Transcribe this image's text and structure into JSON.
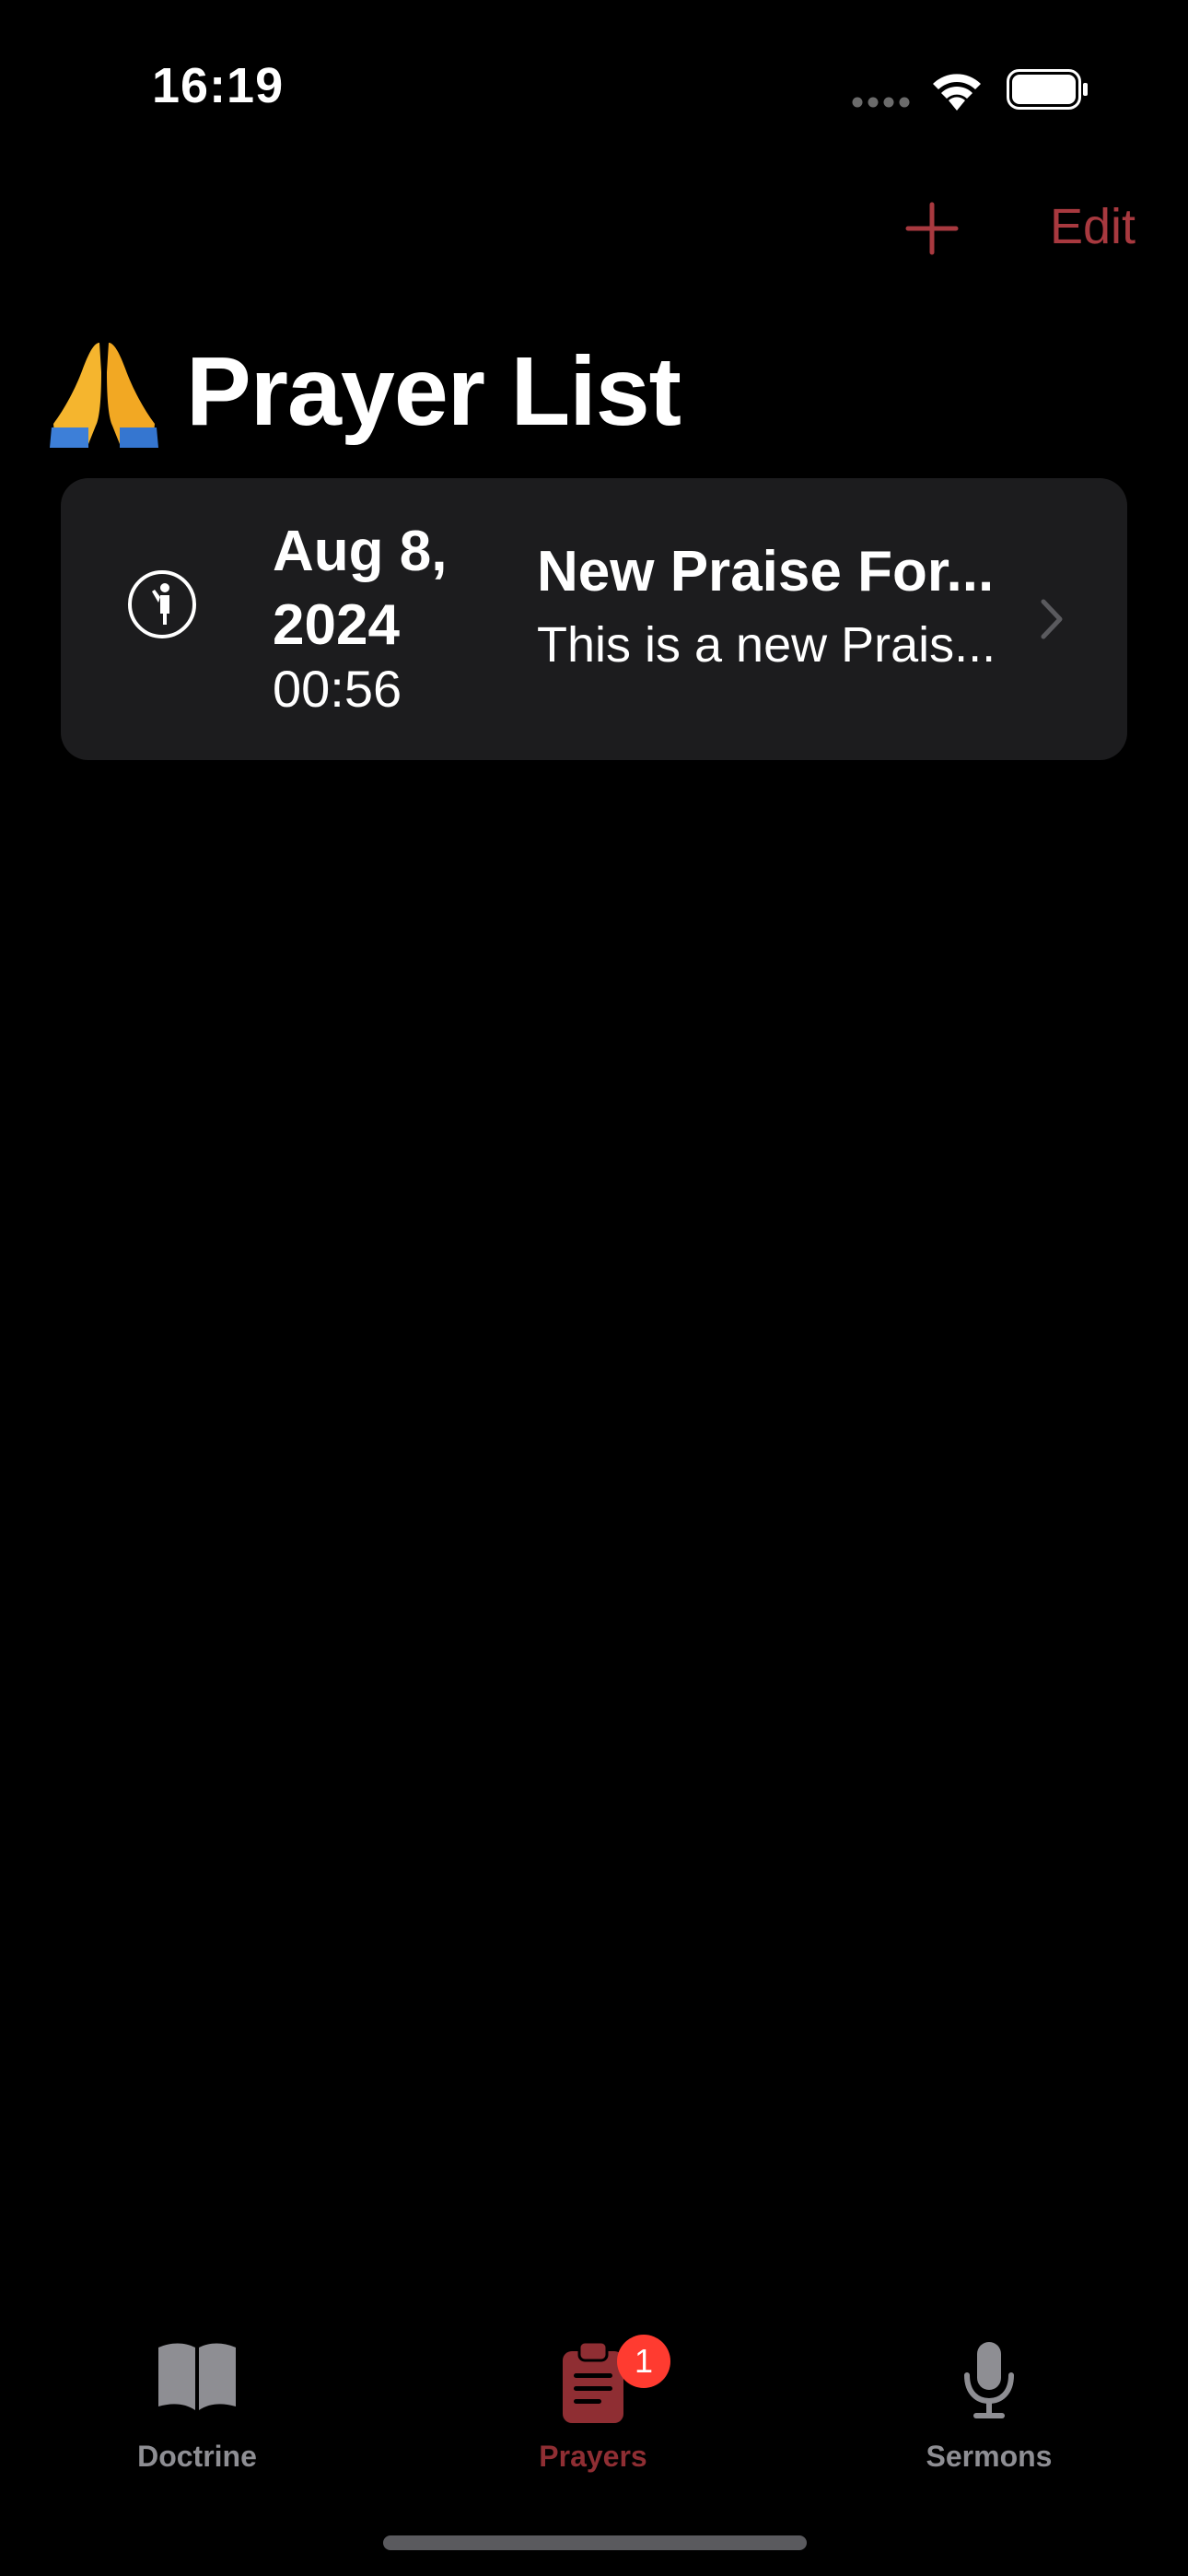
{
  "status_bar": {
    "time": "16:19",
    "icons": [
      "cellular-signal-icon",
      "wifi-icon",
      "battery-icon"
    ]
  },
  "nav": {
    "add_icon": "plus-icon",
    "edit_label": "Edit",
    "accent_color": "#a8393f"
  },
  "page": {
    "emoji_icon": "folded-hands-icon",
    "title": "Prayer List"
  },
  "list": {
    "items": [
      {
        "icon": "person-praying-icon",
        "date": "Aug 8, 2024",
        "time": "00:56",
        "title": "New Praise For...",
        "subtitle": "This is a new Prais..."
      }
    ]
  },
  "tab_bar": {
    "tabs": [
      {
        "label": "Doctrine",
        "icon": "book-icon",
        "active": false
      },
      {
        "label": "Prayers",
        "icon": "clipboard-icon",
        "active": true,
        "badge": "1"
      },
      {
        "label": "Sermons",
        "icon": "microphone-icon",
        "active": false
      }
    ],
    "active_color": "#8f2e33",
    "inactive_color": "#8e8e93",
    "badge_color": "#ff3b30"
  }
}
